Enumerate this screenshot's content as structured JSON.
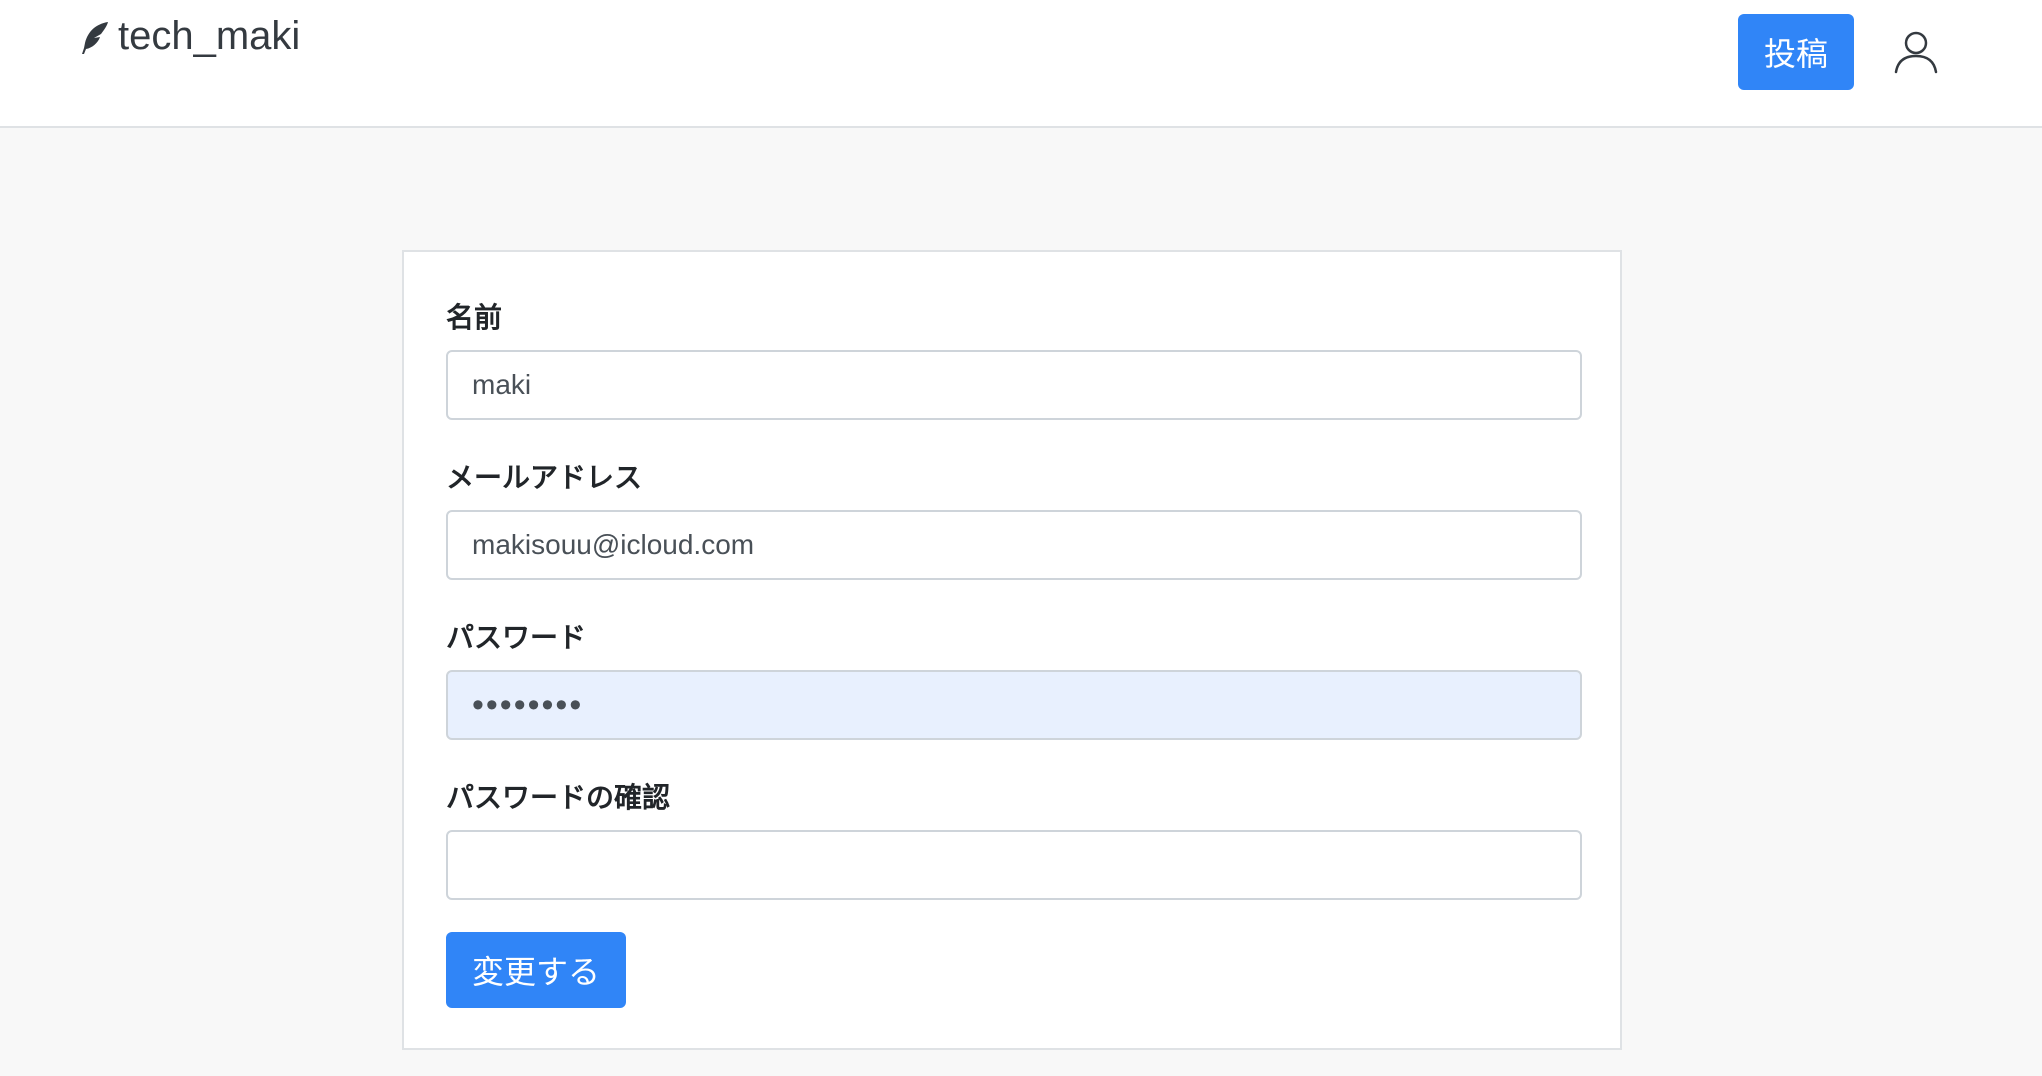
{
  "navbar": {
    "brand_label": "tech_maki",
    "brand_icon": "feather-icon",
    "post_button_label": "投稿",
    "user_icon": "user-icon"
  },
  "form": {
    "name": {
      "label": "名前",
      "value": "maki"
    },
    "email": {
      "label": "メールアドレス",
      "value": "makisouu@icloud.com"
    },
    "password": {
      "label": "パスワード",
      "value": "12345678"
    },
    "password_confirmation": {
      "label": "パスワードの確認",
      "value": ""
    },
    "submit_label": "変更する"
  },
  "colors": {
    "primary": "#3085f7",
    "autofill_bg": "#e8f0fe",
    "page_bg": "#f8f8f8"
  }
}
